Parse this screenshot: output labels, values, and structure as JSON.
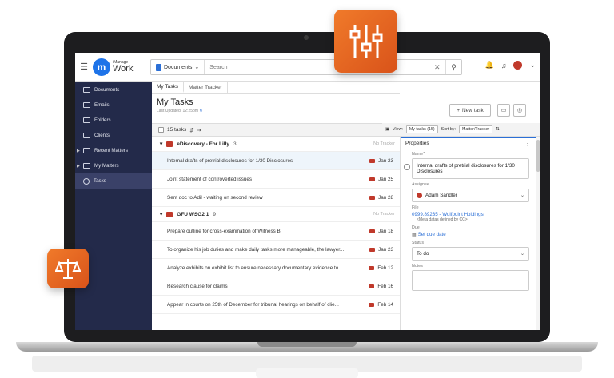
{
  "header": {
    "logo_small": "iManage",
    "logo_big": "Work",
    "logo_mark": "m",
    "scope_label": "Documents",
    "search_placeholder": "Search"
  },
  "sidebar": {
    "items": [
      {
        "label": "Documents"
      },
      {
        "label": "Emails"
      },
      {
        "label": "Folders"
      },
      {
        "label": "Clients"
      },
      {
        "label": "Recent Matters"
      },
      {
        "label": "My Matters"
      },
      {
        "label": "Tasks"
      }
    ]
  },
  "tabs": [
    "My Tasks",
    "Matter Tracker"
  ],
  "page": {
    "title": "My Tasks",
    "updated": "Last Updated: 12:25pm",
    "new_task": "New task",
    "task_count": "15 tasks"
  },
  "viewbar": {
    "view_label": "View:",
    "view_value": "My tasks (15)",
    "sort_label": "Sort by:",
    "sort_value": "Matter/Tracker"
  },
  "groups": [
    {
      "name": "eDiscovery - For Lilly",
      "count": "3",
      "tracker": "No Tracker",
      "tasks": [
        {
          "text": "Internal drafts of pretrial disclosures for 1/30 Disclosures",
          "date": "Jan 23"
        },
        {
          "text": "Joint statement of controverted issues",
          "date": "Jan 25"
        },
        {
          "text": "Sent doc to Adil - waiting on second review",
          "date": "Jan 28"
        }
      ]
    },
    {
      "name": "GFU WSG2 1",
      "count": "9",
      "tracker": "No Tracker",
      "tasks": [
        {
          "text": "Prepare outline for cross-examination of Witness B",
          "date": "Jan 18"
        },
        {
          "text": "To organize his job duties and make daily tasks more manageable, the lawyer...",
          "date": "Jan 23"
        },
        {
          "text": "Analyze exhibits on exhibit list to ensure necessary documentary evidence to...",
          "date": "Feb 12"
        },
        {
          "text": "Research clause for claims",
          "date": "Feb 16"
        },
        {
          "text": "Appear in courts on 25th of December for tribunal hearings on behalf of clie...",
          "date": "Feb 14"
        }
      ]
    }
  ],
  "properties": {
    "title": "Properties",
    "name_label": "Name*",
    "name_value": "Internal drafts of pretrial disclosures for 1/30 Disclosures",
    "assignee_label": "Assignee",
    "assignee_value": "Adam Sandler",
    "file_label": "File",
    "file_value": "0999.89235 - Wolfpoint Holdings",
    "file_meta": "<Meta datas defined by CC>",
    "due_label": "Due",
    "due_value": "Set due date",
    "status_label": "Status",
    "status_value": "To do",
    "notes_label": "Notes"
  },
  "colors": {
    "accent": "#2b6fd6",
    "sidebar": "#232a4a",
    "badge": "#e8672a"
  }
}
